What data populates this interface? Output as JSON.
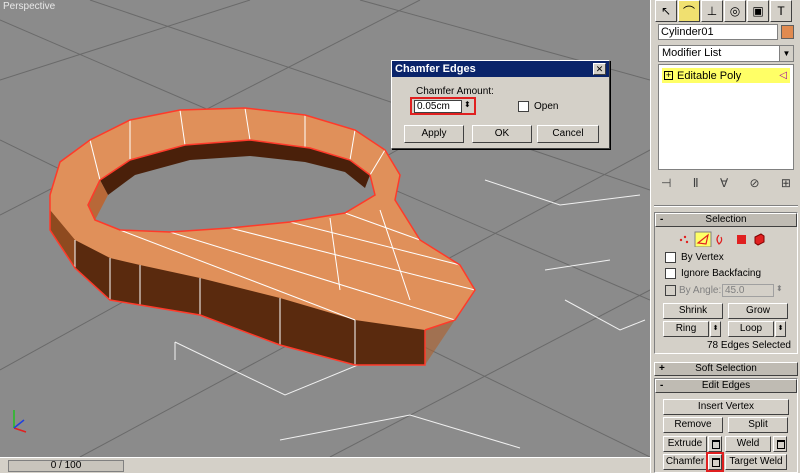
{
  "viewport": {
    "label": "Perspective"
  },
  "timeline": {
    "frame": "0 / 100"
  },
  "command_panel": {
    "tabs": [
      "create",
      "modify",
      "hierarchy",
      "motion",
      "display",
      "utilities"
    ],
    "object_name": "Cylinder01",
    "object_color": "#e08a50",
    "modifier_list": "Modifier List",
    "stack_item": "Editable Poly"
  },
  "selection": {
    "title": "Selection",
    "by_vertex": "By Vertex",
    "ignore_backfacing": "Ignore Backfacing",
    "by_angle": "By Angle:",
    "angle_value": "45.0",
    "shrink": "Shrink",
    "grow": "Grow",
    "ring": "Ring",
    "loop": "Loop",
    "status": "78 Edges Selected"
  },
  "soft_selection": {
    "title": "Soft Selection"
  },
  "edit_edges": {
    "title": "Edit Edges",
    "insert_vertex": "Insert Vertex",
    "remove": "Remove",
    "split": "Split",
    "extrude": "Extrude",
    "weld": "Weld",
    "chamfer": "Chamfer",
    "target_weld": "Target Weld"
  },
  "dialog": {
    "title": "Chamfer Edges",
    "amount_label": "Chamfer Amount:",
    "amount_value": "0.05cm",
    "open_label": "Open",
    "apply": "Apply",
    "ok": "OK",
    "cancel": "Cancel"
  },
  "colors": {
    "highlight": "#e02020",
    "title_bar": "#0a246a",
    "viewport_bg": "#8b8b8b",
    "object": "#e08a50"
  }
}
